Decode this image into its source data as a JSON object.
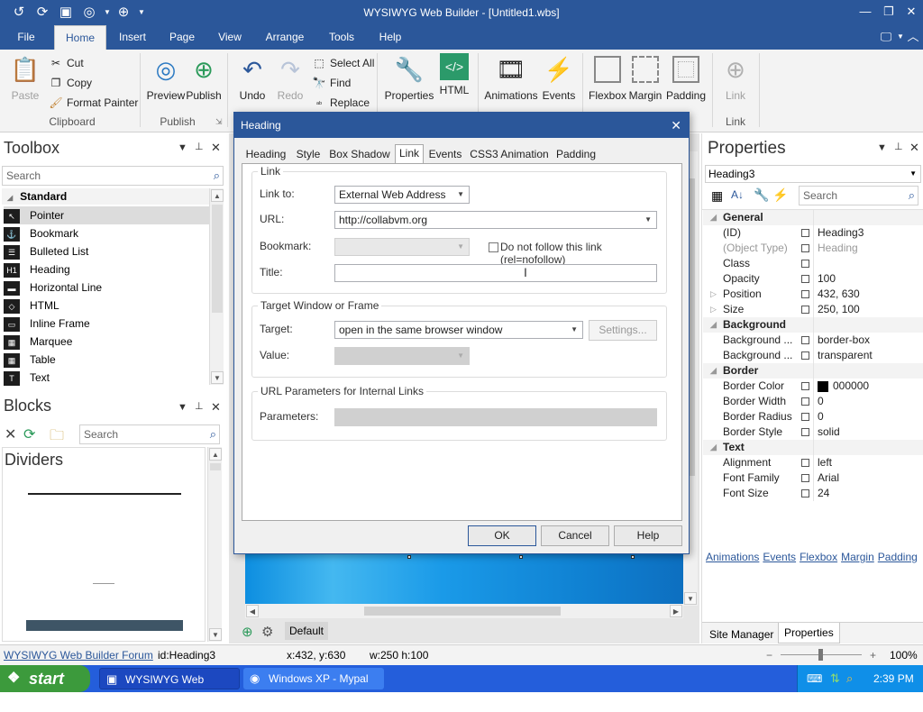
{
  "app": {
    "title": "WYSIWYG Web Builder - [Untitled1.wbs]"
  },
  "ribbon_tabs": [
    "File",
    "Home",
    "Insert",
    "Page",
    "View",
    "Arrange",
    "Tools",
    "Help"
  ],
  "ribbon": {
    "paste": "Paste",
    "cut": "Cut",
    "copy": "Copy",
    "format_painter": "Format Painter",
    "clipboard": "Clipboard",
    "preview": "Preview",
    "publish": "Publish",
    "publish_group": "Publish",
    "undo": "Undo",
    "redo": "Redo",
    "select_all": "Select All",
    "find": "Find",
    "replace": "Replace",
    "properties": "Properties",
    "html": "HTML",
    "animations": "Animations",
    "events": "Events",
    "flexbox": "Flexbox",
    "margin": "Margin",
    "padding": "Padding",
    "link": "Link",
    "link_group": "Link"
  },
  "toolbox": {
    "title": "Toolbox",
    "search_placeholder": "Search",
    "category": "Standard",
    "items": [
      {
        "label": "Pointer",
        "icon": "pointer-icon"
      },
      {
        "label": "Bookmark",
        "icon": "bookmark-icon"
      },
      {
        "label": "Bulleted List",
        "icon": "bulleted-list-icon"
      },
      {
        "label": "Heading",
        "icon": "heading-icon"
      },
      {
        "label": "Horizontal Line",
        "icon": "horizontal-line-icon"
      },
      {
        "label": "HTML",
        "icon": "html-icon"
      },
      {
        "label": "Inline Frame",
        "icon": "inline-frame-icon"
      },
      {
        "label": "Marquee",
        "icon": "marquee-icon"
      },
      {
        "label": "Table",
        "icon": "table-icon"
      },
      {
        "label": "Text",
        "icon": "text-icon"
      }
    ]
  },
  "blocks": {
    "title": "Blocks",
    "search_placeholder": "Search",
    "category": "Dividers"
  },
  "properties": {
    "title": "Properties",
    "object": "Heading3",
    "search_placeholder": "Search",
    "rows": [
      {
        "key": "General",
        "cat": true
      },
      {
        "key": "(ID)",
        "value": "Heading3"
      },
      {
        "key": "(Object Type)",
        "value": "Heading",
        "dim": true
      },
      {
        "key": "Class",
        "value": ""
      },
      {
        "key": "Opacity",
        "value": "100"
      },
      {
        "key": "Position",
        "value": "432, 630",
        "exp": true
      },
      {
        "key": "Size",
        "value": "250, 100",
        "exp": true
      },
      {
        "key": "Background",
        "cat": true
      },
      {
        "key": "Background ...",
        "value": "border-box"
      },
      {
        "key": "Background ...",
        "value": "transparent"
      },
      {
        "key": "Border",
        "cat": true
      },
      {
        "key": "Border Color",
        "value": "000000",
        "swatch": "#000000"
      },
      {
        "key": "Border Width",
        "value": "0"
      },
      {
        "key": "Border Radius",
        "value": "0"
      },
      {
        "key": "Border Style",
        "value": "solid"
      },
      {
        "key": "Text",
        "cat": true
      },
      {
        "key": "Alignment",
        "value": "left"
      },
      {
        "key": "Font Family",
        "value": "Arial"
      },
      {
        "key": "Font Size",
        "value": "24"
      }
    ],
    "links": [
      "Animations",
      "Events",
      "Flexbox",
      "Margin",
      "Padding"
    ],
    "bottom_tabs": [
      "Site Manager",
      "Properties"
    ]
  },
  "canvas": {
    "page_tab": "Default"
  },
  "dialog": {
    "title": "Heading",
    "tabs": [
      "Heading",
      "Style",
      "Box Shadow",
      "Link",
      "Events",
      "CSS3 Animation",
      "Padding"
    ],
    "active_tab": "Link",
    "link_group": {
      "legend": "Link",
      "link_to_label": "Link to:",
      "link_to_value": "External Web Address",
      "url_label": "URL:",
      "url_value": "http://collabvm.org",
      "bookmark_label": "Bookmark:",
      "bookmark_value": "",
      "nofollow_label": "Do not follow this link (rel=nofollow)",
      "title_label": "Title:",
      "title_value": ""
    },
    "target_group": {
      "legend": "Target Window or Frame",
      "target_label": "Target:",
      "target_value": "open in the same browser window",
      "settings_button": "Settings...",
      "value_label": "Value:",
      "value_value": ""
    },
    "params_group": {
      "legend": "URL Parameters for Internal Links",
      "params_label": "Parameters:",
      "params_value": ""
    },
    "ok": "OK",
    "cancel": "Cancel",
    "help": "Help"
  },
  "status": {
    "forum_link": "WYSIWYG Web Builder Forum",
    "id": "id:Heading3",
    "pos": "x:432, y:630",
    "size": "w:250 h:100",
    "zoom": "100%"
  },
  "taskbar": {
    "start": "start",
    "items": [
      "WYSIWYG Web Build...",
      "Windows XP - Mypal"
    ],
    "time": "2:39 PM"
  }
}
